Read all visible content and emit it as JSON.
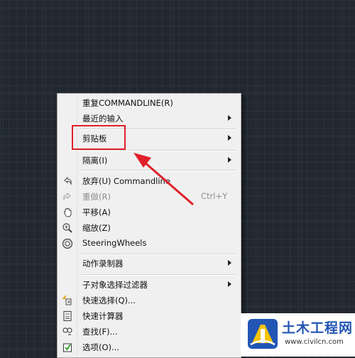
{
  "context_menu": {
    "items": [
      {
        "label": "重复COMMANDLINE(R)"
      },
      {
        "label": "最近的输入"
      },
      {
        "label": "剪贴板"
      },
      {
        "label": "隔离(I)"
      },
      {
        "label": "放弃(U) Commandline"
      },
      {
        "label": "重做(R)",
        "shortcut": "Ctrl+Y"
      },
      {
        "label": "平移(A)"
      },
      {
        "label": "缩放(Z)"
      },
      {
        "label": "SteeringWheels"
      },
      {
        "label": "动作录制器"
      },
      {
        "label": "子对象选择过滤器"
      },
      {
        "label": "快速选择(Q)..."
      },
      {
        "label": "快速计算器"
      },
      {
        "label": "查找(F)..."
      },
      {
        "label": "选项(O)..."
      }
    ]
  },
  "annotation": {
    "highlight_color": "#e0202a"
  },
  "watermark": {
    "title": "土木工程网",
    "url": "www.civilcn.com"
  },
  "colors": {
    "canvas": "#212830",
    "menu_bg": "#f0f0f0",
    "watermark_blue": "#2256b5"
  }
}
